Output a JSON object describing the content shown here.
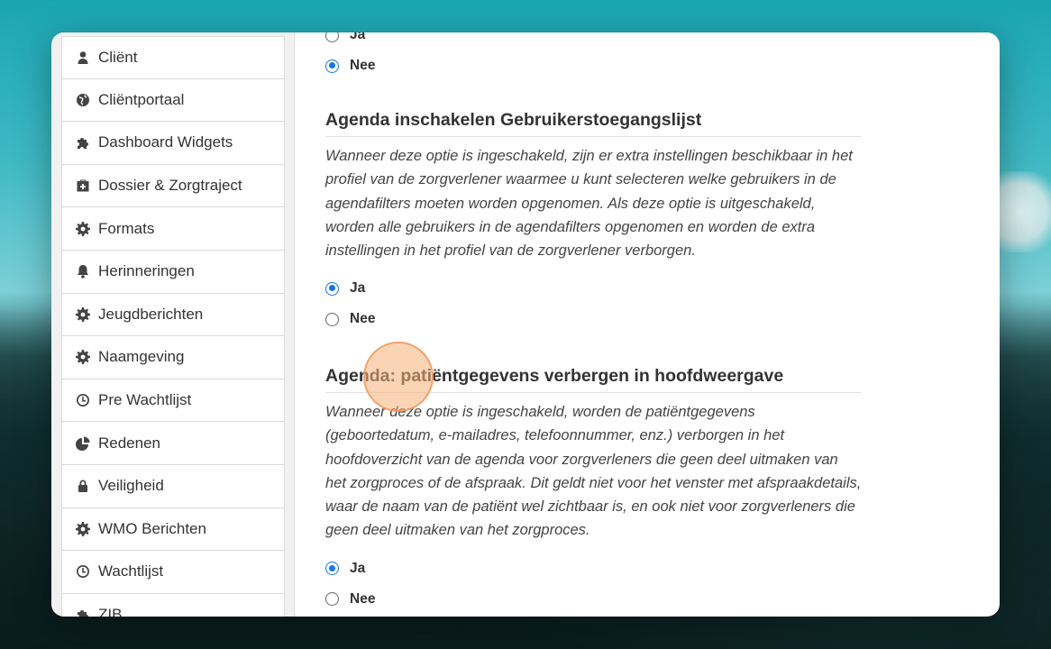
{
  "sidebar": {
    "items": [
      {
        "label": "Cliënt",
        "icon": "user-icon"
      },
      {
        "label": "Cliëntportaal",
        "icon": "globe-icon"
      },
      {
        "label": "Dashboard Widgets",
        "icon": "puzzle-icon"
      },
      {
        "label": "Dossier & Zorgtraject",
        "icon": "medkit-icon"
      },
      {
        "label": "Formats",
        "icon": "gear-icon"
      },
      {
        "label": "Herinneringen",
        "icon": "bell-icon"
      },
      {
        "label": "Jeugdberichten",
        "icon": "gear-icon"
      },
      {
        "label": "Naamgeving",
        "icon": "gear-icon"
      },
      {
        "label": "Pre Wachtlijst",
        "icon": "clock-icon"
      },
      {
        "label": "Redenen",
        "icon": "pie-chart-icon"
      },
      {
        "label": "Veiligheid",
        "icon": "lock-icon"
      },
      {
        "label": "WMO Berichten",
        "icon": "gear-icon"
      },
      {
        "label": "Wachtlijst",
        "icon": "clock-icon"
      },
      {
        "label": "ZIB",
        "icon": "puzzle-icon"
      }
    ]
  },
  "top_option": {
    "partial_label": "Ja",
    "nee_label": "Nee"
  },
  "section1": {
    "title": "Agenda inschakelen Gebruikerstoegangslijst",
    "description": "Wanneer deze optie is ingeschakeld, zijn er extra instellingen beschikbaar in het profiel van de zorgverlener waarmee u kunt selecteren welke gebruikers in de agendafilters moeten worden opgenomen. Als deze optie is uitgeschakeld, worden alle gebruikers in de agendafilters opgenomen en worden de extra instellingen in het profiel van de zorgverlener verborgen.",
    "option_yes": "Ja",
    "option_no": "Nee",
    "selected": "Ja"
  },
  "section2": {
    "title": "Agenda: patiëntgegevens verbergen in hoofdweergave",
    "description": "Wanneer deze optie is ingeschakeld, worden de patiëntgegevens (geboortedatum, e-mailadres, telefoonnummer, enz.) verborgen in het hoofdoverzicht van de agenda voor zorgverleners die geen deel uitmaken van het zorgproces of de afspraak. Dit geldt niet voor het venster met afspraakdetails, waar de naam van de patiënt wel zichtbaar is, en ook niet voor zorgverleners die geen deel uitmaken van het zorgproces.",
    "option_yes": "Ja",
    "option_no": "Nee",
    "selected": "Ja"
  },
  "colors": {
    "accent": "#1a73e8",
    "cursor_highlight": "#f7b078"
  }
}
